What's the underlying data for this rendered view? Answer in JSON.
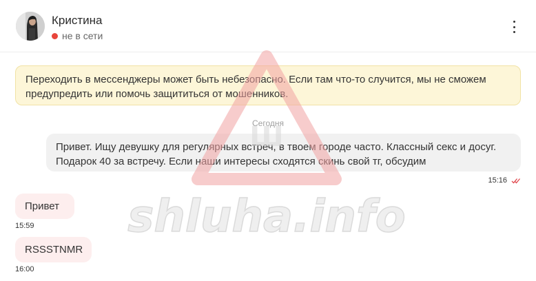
{
  "contact": {
    "name": "Кристина",
    "status": "не в сети",
    "status_color": "#e8453c"
  },
  "header": {
    "menu_icon": "more-vertical-icon"
  },
  "warning": {
    "text": "Переходить в мессенджеры может быть небезопасно. Если там что-то случится, мы не сможем предупредить или помочь защититься от мошенников."
  },
  "date_separator": "Сегодня",
  "messages": [
    {
      "direction": "out",
      "text": "Привет. Ищу девушку для регулярных встреч, в твоем городе часто. Классный секс и досуг. Подарок 40 за встречу. Если наши интересы сходятся скинь свой тг, обсудим",
      "time": "15:16",
      "status": "read",
      "status_color": "#e0474c"
    },
    {
      "direction": "in",
      "text": "Привет",
      "time": "15:59"
    },
    {
      "direction": "in",
      "text": "RSSSTNMR",
      "time": "16:00"
    }
  ],
  "watermark": {
    "logo_letter": "Ш",
    "site": "shluha.info",
    "color": "#f08a8a"
  }
}
